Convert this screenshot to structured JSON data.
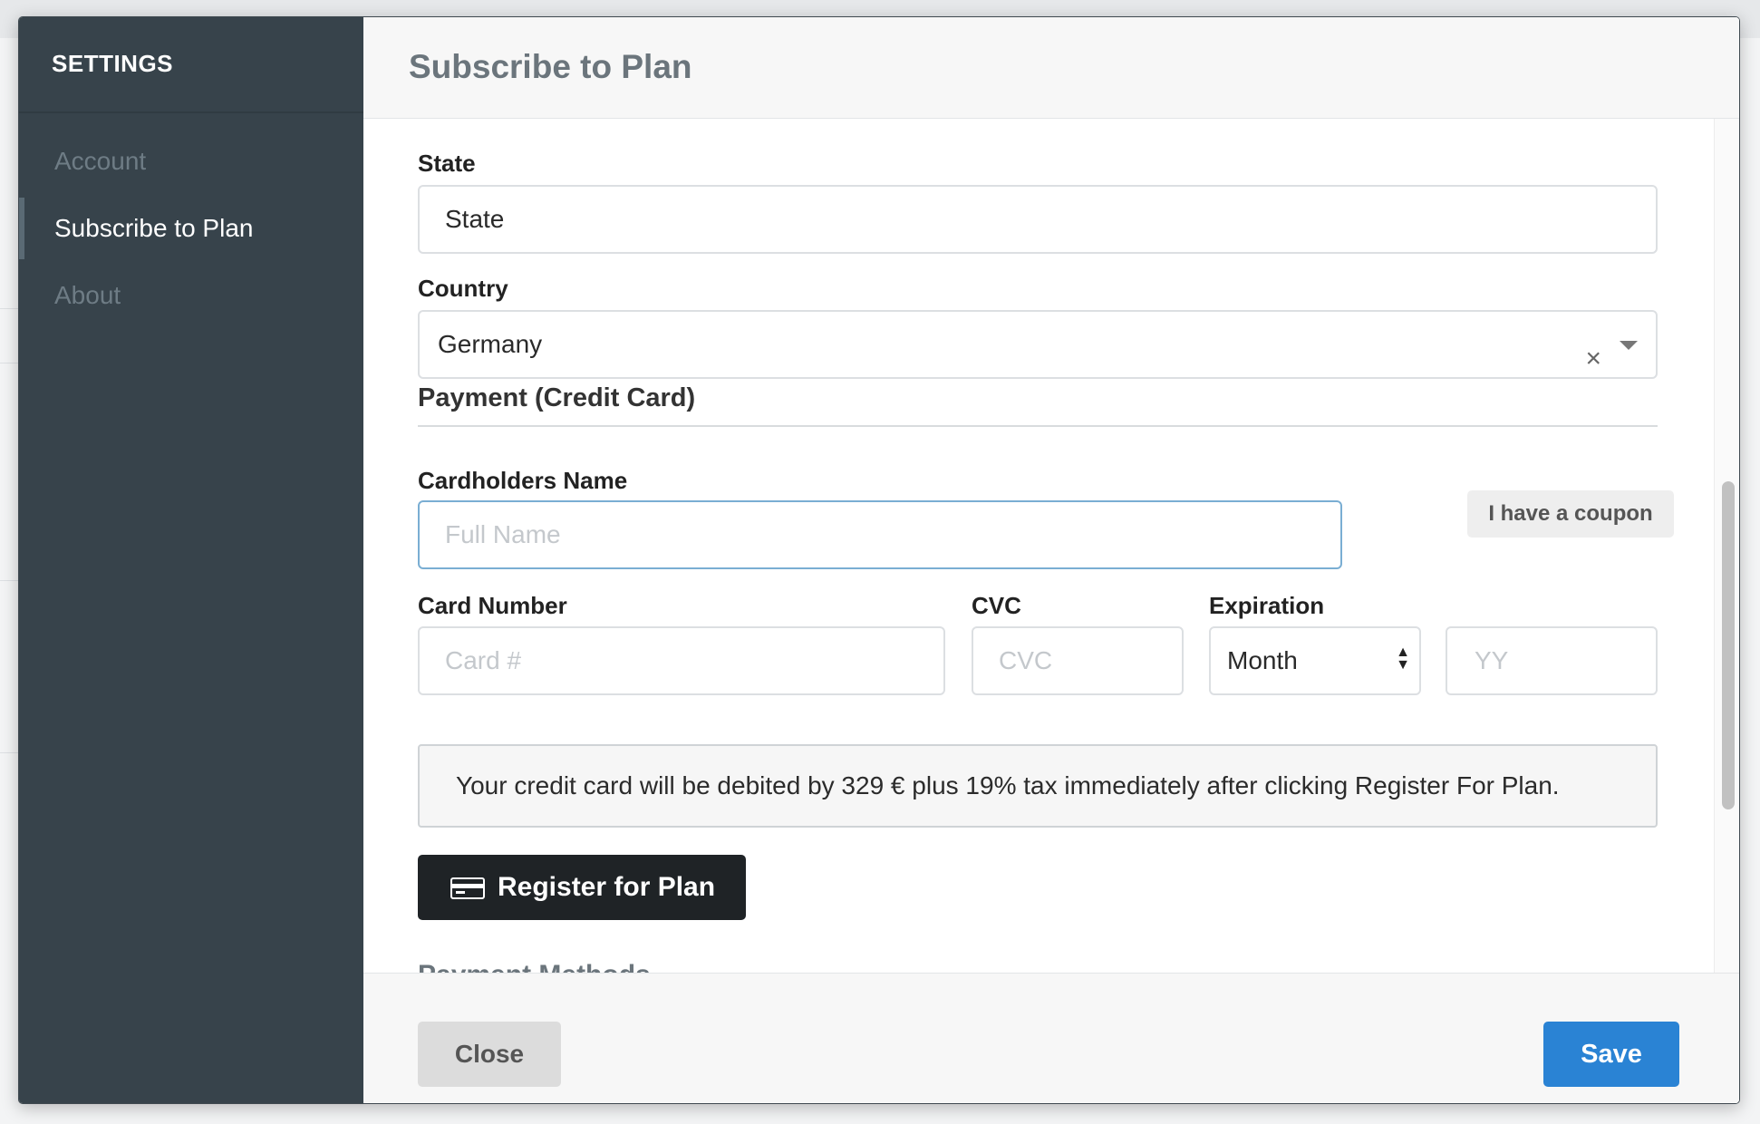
{
  "sidebar": {
    "title": "SETTINGS",
    "items": [
      {
        "label": "Account"
      },
      {
        "label": "Subscribe to Plan"
      },
      {
        "label": "About"
      }
    ]
  },
  "header": {
    "title": "Subscribe to Plan"
  },
  "form": {
    "state": {
      "label": "State",
      "value": "State"
    },
    "country": {
      "label": "Country",
      "value": "Germany",
      "clear_glyph": "×"
    },
    "payment_section": "Payment (Credit Card)",
    "cardholder": {
      "label": "Cardholders Name",
      "placeholder": "Full Name"
    },
    "coupon_label": "I have a coupon",
    "card_number": {
      "label": "Card Number",
      "placeholder": "Card #"
    },
    "cvc": {
      "label": "CVC",
      "placeholder": "CVC"
    },
    "expiration": {
      "label": "Expiration",
      "month_value": "Month",
      "year_placeholder": "YY"
    },
    "notice": "Your credit card will be debited by 329 € plus 19% tax immediately after clicking Register For Plan.",
    "register_label": "Register for Plan",
    "payment_methods_title": "Payment Methods"
  },
  "footer": {
    "close_label": "Close",
    "save_label": "Save"
  },
  "colors": {
    "sidebar_bg": "#37434b",
    "save_button": "#2a83d4",
    "register_button": "#1f2326"
  },
  "icons": {
    "register": "credit-card-icon",
    "country_clear": "close-icon",
    "country_caret": "caret-down-icon",
    "month_arrows": "sort-icon"
  }
}
